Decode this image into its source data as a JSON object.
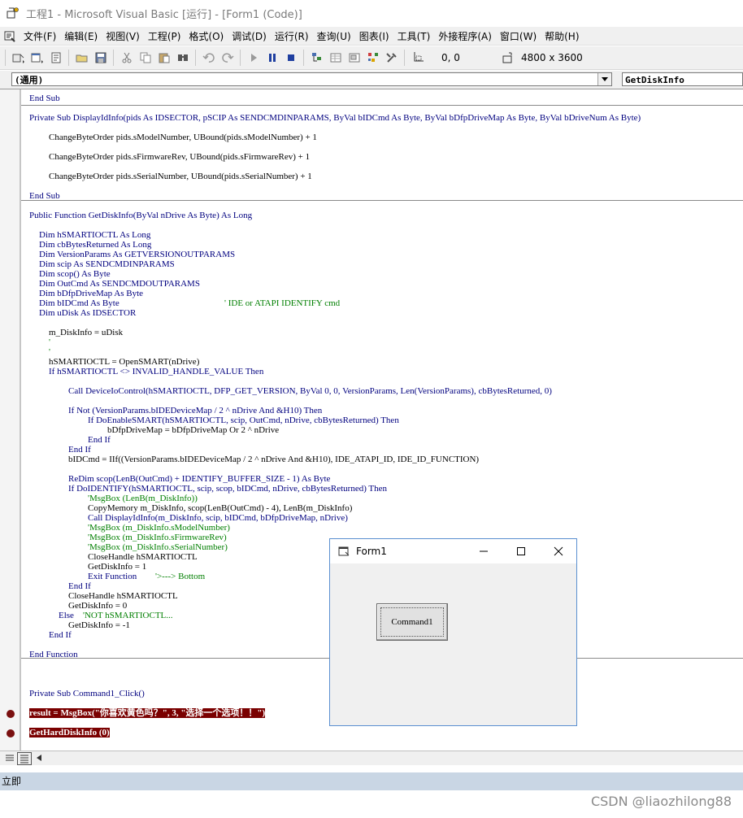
{
  "window": {
    "title": "工程1 - Microsoft Visual Basic [运行] - [Form1 (Code)]"
  },
  "menu": [
    {
      "name": "menu-file",
      "label": "文件(F)"
    },
    {
      "name": "menu-edit",
      "label": "编辑(E)"
    },
    {
      "name": "menu-view",
      "label": "视图(V)"
    },
    {
      "name": "menu-project",
      "label": "工程(P)"
    },
    {
      "name": "menu-format",
      "label": "格式(O)"
    },
    {
      "name": "menu-debug",
      "label": "调试(D)"
    },
    {
      "name": "menu-run",
      "label": "运行(R)"
    },
    {
      "name": "menu-query",
      "label": "查询(U)"
    },
    {
      "name": "menu-diagram",
      "label": "图表(I)"
    },
    {
      "name": "menu-tools",
      "label": "工具(T)"
    },
    {
      "name": "menu-addins",
      "label": "外接程序(A)"
    },
    {
      "name": "menu-window",
      "label": "窗口(W)"
    },
    {
      "name": "menu-help",
      "label": "帮助(H)"
    }
  ],
  "toolbar": {
    "position": "0, 0",
    "size": "4800 x 3600"
  },
  "combos": {
    "object": "(通用)",
    "procedure": "GetDiskInfo"
  },
  "code": {
    "lines": [
      "End Sub",
      "Private Sub DisplayIdInfo(pids As IDSECTOR, pSCIP As SENDCMDINPARAMS, ByVal bIDCmd As Byte, ByVal bDfpDriveMap As Byte, ByVal bDriveNum As Byte)",
      "ChangeByteOrder pids.sModelNumber, UBound(pids.sModelNumber) + 1",
      "ChangeByteOrder pids.sFirmwareRev, UBound(pids.sFirmwareRev) + 1",
      "ChangeByteOrder pids.sSerialNumber, UBound(pids.sSerialNumber) + 1",
      "End Sub",
      "Public Function GetDiskInfo(ByVal nDrive As Byte) As Long",
      "Dim hSMARTIOCTL As Long",
      "Dim cbBytesReturned As Long",
      "Dim VersionParams As GETVERSIONOUTPARAMS",
      "Dim scip As SENDCMDINPARAMS",
      "Dim scop() As Byte",
      "Dim OutCmd As SENDCMDOUTPARAMS",
      "Dim bDfpDriveMap As Byte",
      "Dim bIDCmd As Byte",
      "' IDE or ATAPI IDENTIFY cmd",
      "Dim uDisk As IDSECTOR",
      "m_DiskInfo = uDisk",
      "'",
      "'",
      "hSMARTIOCTL = OpenSMART(nDrive)",
      "If hSMARTIOCTL <> INVALID_HANDLE_VALUE Then",
      "Call DeviceIoControl(hSMARTIOCTL, DFP_GET_VERSION, ByVal 0, 0, VersionParams, Len(VersionParams), cbBytesReturned, 0)",
      "If Not (VersionParams.bIDEDeviceMap / 2 ^ nDrive And &H10) Then",
      "If DoEnableSMART(hSMARTIOCTL, scip, OutCmd, nDrive, cbBytesReturned) Then",
      "bDfpDriveMap = bDfpDriveMap Or 2 ^ nDrive",
      "End If",
      "End If",
      "bIDCmd = IIf((VersionParams.bIDEDeviceMap / 2 ^ nDrive And &H10), IDE_ATAPI_ID, IDE_ID_FUNCTION)",
      "ReDim scop(LenB(OutCmd) + IDENTIFY_BUFFER_SIZE - 1) As Byte",
      "If DoIDENTIFY(hSMARTIOCTL, scip, scop, bIDCmd, nDrive, cbBytesReturned) Then",
      "'MsgBox (LenB(m_DiskInfo))",
      "CopyMemory m_DiskInfo, scop(LenB(OutCmd) - 4), LenB(m_DiskInfo)",
      "Call DisplayIdInfo(m_DiskInfo, scip, bIDCmd, bDfpDriveMap, nDrive)",
      "'MsgBox (m_DiskInfo.sModelNumber)",
      "'MsgBox (m_DiskInfo.sFirmwareRev)",
      "'MsgBox (m_DiskInfo.sSerialNumber)",
      "CloseHandle hSMARTIOCTL",
      "GetDiskInfo = 1",
      "Exit Function",
      "'>---> Bottom",
      "End If",
      "CloseHandle hSMARTIOCTL",
      "GetDiskInfo = 0",
      "Else",
      "'NOT hSMARTIOCTL...",
      "GetDiskInfo = -1",
      "End If",
      "End Function",
      "Private Sub Command1_Click()",
      "result = MsgBox(\"你喜欢黄色吗？\", 3, \"选择一个选项！！\")",
      "GetHardDiskInfo (0)"
    ]
  },
  "immediate": {
    "title": "立即"
  },
  "form1": {
    "title": "Form1",
    "button_label": "Command1"
  },
  "watermark": "CSDN @liaozhilong88"
}
